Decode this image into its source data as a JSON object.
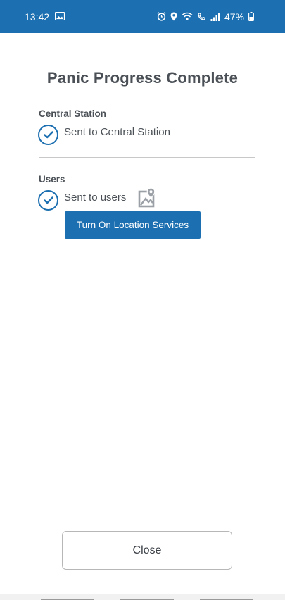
{
  "status_bar": {
    "time": "13:42",
    "battery": "47%",
    "icons": [
      "gallery-icon",
      "alarm-icon",
      "location-pin-icon",
      "wifi-icon",
      "wifi-call-icon",
      "signal-icon",
      "battery-icon"
    ]
  },
  "header": {
    "title": "Panic Progress Complete"
  },
  "central_station": {
    "label": "Central Station",
    "status_text": "Sent to Central Station"
  },
  "users": {
    "label": "Users",
    "status_text": "Sent to users",
    "location_button": "Turn On Location Services"
  },
  "footer": {
    "close_label": "Close"
  },
  "colors": {
    "brand_blue": "#1c6fb0",
    "text_dark": "#4a5056",
    "divider": "#c8c8c8"
  }
}
